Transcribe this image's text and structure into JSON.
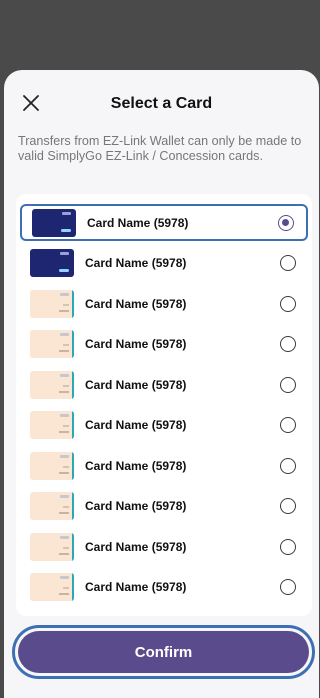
{
  "header": {
    "title": "Select a Card",
    "close_icon": "close-icon"
  },
  "notice": "Transfers from EZ-Link Wallet can only be made to valid SimplyGo EZ-Link / Concession cards.",
  "cards": [
    {
      "label": "Card Name (5978)",
      "style": "blue",
      "selected": true
    },
    {
      "label": "Card Name (5978)",
      "style": "blue",
      "selected": false
    },
    {
      "label": "Card Name (5978)",
      "style": "peach",
      "selected": false
    },
    {
      "label": "Card Name (5978)",
      "style": "peach",
      "selected": false
    },
    {
      "label": "Card Name (5978)",
      "style": "peach",
      "selected": false
    },
    {
      "label": "Card Name (5978)",
      "style": "peach",
      "selected": false
    },
    {
      "label": "Card Name (5978)",
      "style": "peach",
      "selected": false
    },
    {
      "label": "Card Name (5978)",
      "style": "peach",
      "selected": false
    },
    {
      "label": "Card Name (5978)",
      "style": "peach",
      "selected": false
    },
    {
      "label": "Card Name (5978)",
      "style": "peach",
      "selected": false
    }
  ],
  "confirm_label": "Confirm",
  "colors": {
    "accent": "#5a4c8c",
    "focus_outline": "#3d6fb3",
    "card_blue": "#1e2672",
    "card_peach": "#fbe6d3"
  }
}
